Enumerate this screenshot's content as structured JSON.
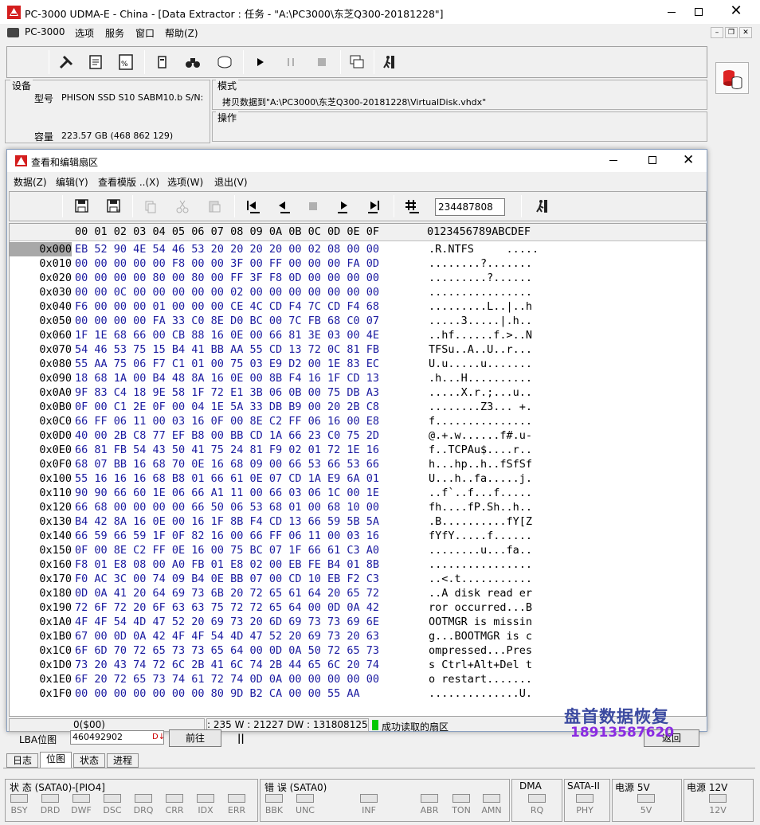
{
  "app": {
    "title": "PC-3000 UDMA-E - China - [Data Extractor : 任务 - \"A:\\PC3000\\东芝Q300-20181228\"]"
  },
  "menubar": [
    "PC-3000",
    "选项",
    "服务",
    "窗口",
    "帮助(Z)"
  ],
  "device": {
    "group": "设备",
    "model_label": "型号",
    "model": "PHISON SSD S10 SABM10.b S/N:",
    "cap_label": "容量",
    "capacity": "223.57 GB (468 862 129)"
  },
  "mode": {
    "label": "模式",
    "text": "拷贝数据到\"A:\\PC3000\\东芝Q300-20181228\\VirtualDisk.vhdx\""
  },
  "operation": {
    "label": "操作"
  },
  "editor": {
    "title": "查看和编辑扇区",
    "menu": [
      "数据(Z)",
      "编辑(Y)",
      "查看模版 ..(X)",
      "选项(W)",
      "退出(V)"
    ],
    "sector_input": "234487808",
    "header_hex": "00 01 02 03 04 05 06 07 08 09 0A 0B 0C 0D 0E 0F",
    "header_ascii": "0123456789ABCDEF",
    "rows": [
      {
        "off": "0x000",
        "hex": "EB 52 90 4E 54 46 53 20 20 20 20 00 02 08 00 00",
        "asc": ".R.NTFS     ....."
      },
      {
        "off": "0x010",
        "hex": "00 00 00 00 00 F8 00 00 3F 00 FF 00 00 00 FA 0D",
        "asc": "........?......."
      },
      {
        "off": "0x020",
        "hex": "00 00 00 00 80 00 80 00 FF 3F F8 0D 00 00 00 00",
        "asc": ".........?......"
      },
      {
        "off": "0x030",
        "hex": "00 00 0C 00 00 00 00 00 02 00 00 00 00 00 00 00",
        "asc": "................"
      },
      {
        "off": "0x040",
        "hex": "F6 00 00 00 01 00 00 00 CE 4C CD F4 7C CD F4 68",
        "asc": ".........L..|..h"
      },
      {
        "off": "0x050",
        "hex": "00 00 00 00 FA 33 C0 8E D0 BC 00 7C FB 68 C0 07",
        "asc": ".....3.....|.h.."
      },
      {
        "off": "0x060",
        "hex": "1F 1E 68 66 00 CB 88 16 0E 00 66 81 3E 03 00 4E",
        "asc": "..hf......f.>..N"
      },
      {
        "off": "0x070",
        "hex": "54 46 53 75 15 B4 41 BB AA 55 CD 13 72 0C 81 FB",
        "asc": "TFSu..A..U..r..."
      },
      {
        "off": "0x080",
        "hex": "55 AA 75 06 F7 C1 01 00 75 03 E9 D2 00 1E 83 EC",
        "asc": "U.u.....u......."
      },
      {
        "off": "0x090",
        "hex": "18 68 1A 00 B4 48 8A 16 0E 00 8B F4 16 1F CD 13",
        "asc": ".h...H.........."
      },
      {
        "off": "0x0A0",
        "hex": "9F 83 C4 18 9E 58 1F 72 E1 3B 06 0B 00 75 DB A3",
        "asc": ".....X.r.;...u.."
      },
      {
        "off": "0x0B0",
        "hex": "0F 00 C1 2E 0F 00 04 1E 5A 33 DB B9 00 20 2B C8",
        "asc": "........Z3... +."
      },
      {
        "off": "0x0C0",
        "hex": "66 FF 06 11 00 03 16 0F 00 8E C2 FF 06 16 00 E8",
        "asc": "f..............."
      },
      {
        "off": "0x0D0",
        "hex": "40 00 2B C8 77 EF B8 00 BB CD 1A 66 23 C0 75 2D",
        "asc": "@.+.w......f#.u-"
      },
      {
        "off": "0x0E0",
        "hex": "66 81 FB 54 43 50 41 75 24 81 F9 02 01 72 1E 16",
        "asc": "f..TCPAu$....r.."
      },
      {
        "off": "0x0F0",
        "hex": "68 07 BB 16 68 70 0E 16 68 09 00 66 53 66 53 66",
        "asc": "h...hp..h..fSfSf"
      },
      {
        "off": "0x100",
        "hex": "55 16 16 16 68 B8 01 66 61 0E 07 CD 1A E9 6A 01",
        "asc": "U...h..fa.....j."
      },
      {
        "off": "0x110",
        "hex": "90 90 66 60 1E 06 66 A1 11 00 66 03 06 1C 00 1E",
        "asc": "..f`..f...f....."
      },
      {
        "off": "0x120",
        "hex": "66 68 00 00 00 00 66 50 06 53 68 01 00 68 10 00",
        "asc": "fh....fP.Sh..h.."
      },
      {
        "off": "0x130",
        "hex": "B4 42 8A 16 0E 00 16 1F 8B F4 CD 13 66 59 5B 5A",
        "asc": ".B..........fY[Z"
      },
      {
        "off": "0x140",
        "hex": "66 59 66 59 1F 0F 82 16 00 66 FF 06 11 00 03 16",
        "asc": "fYfY.....f......"
      },
      {
        "off": "0x150",
        "hex": "0F 00 8E C2 FF 0E 16 00 75 BC 07 1F 66 61 C3 A0",
        "asc": "........u...fa.."
      },
      {
        "off": "0x160",
        "hex": "F8 01 E8 08 00 A0 FB 01 E8 02 00 EB FE B4 01 8B",
        "asc": "................"
      },
      {
        "off": "0x170",
        "hex": "F0 AC 3C 00 74 09 B4 0E BB 07 00 CD 10 EB F2 C3",
        "asc": "..<.t..........."
      },
      {
        "off": "0x180",
        "hex": "0D 0A 41 20 64 69 73 6B 20 72 65 61 64 20 65 72",
        "asc": "..A disk read er"
      },
      {
        "off": "0x190",
        "hex": "72 6F 72 20 6F 63 63 75 72 72 65 64 00 0D 0A 42",
        "asc": "ror occurred...B"
      },
      {
        "off": "0x1A0",
        "hex": "4F 4F 54 4D 47 52 20 69 73 20 6D 69 73 73 69 6E",
        "asc": "OOTMGR is missin"
      },
      {
        "off": "0x1B0",
        "hex": "67 00 0D 0A 42 4F 4F 54 4D 47 52 20 69 73 20 63",
        "asc": "g...BOOTMGR is c"
      },
      {
        "off": "0x1C0",
        "hex": "6F 6D 70 72 65 73 73 65 64 00 0D 0A 50 72 65 73",
        "asc": "ompressed...Pres"
      },
      {
        "off": "0x1D0",
        "hex": "73 20 43 74 72 6C 2B 41 6C 74 2B 44 65 6C 20 74",
        "asc": "s Ctrl+Alt+Del t"
      },
      {
        "off": "0x1E0",
        "hex": "6F 20 72 65 73 74 61 72 74 0D 0A 00 00 00 00 00",
        "asc": "o restart......."
      },
      {
        "off": "0x1F0",
        "hex": "00 00 00 00 00 00 00 80 9D B2 CA 00 00 55 AA",
        "asc": "..............U."
      }
    ],
    "status_pos": "0($00)",
    "status_mid": ": 235 W : 21227 DW : 131808125",
    "status_ok": "成功读取的扇区"
  },
  "lba": {
    "label": "LBA位图",
    "value": "460492902",
    "btn": "前往",
    "btn2": "返回"
  },
  "tabs": [
    "日志",
    "位图",
    "状态",
    "进程"
  ],
  "status": {
    "state_label": "状 态 (SATA0)-[PIO4]",
    "state_leds": [
      "BSY",
      "DRD",
      "DWF",
      "DSC",
      "DRQ",
      "CRR",
      "IDX",
      "ERR"
    ],
    "err_label": "错 误 (SATA0)",
    "err_leds": [
      "BBK",
      "UNC",
      "INF",
      "ABR",
      "TON",
      "AMN"
    ],
    "dma_label": "DMA",
    "dma_led": "RQ",
    "sata_label": "SATA-II",
    "sata_led": "PHY",
    "pw5_label": "电源 5V",
    "pw5_led": "5V",
    "pw12_label": "电源 12V",
    "pw12_led": "12V"
  },
  "watermark": {
    "line1": "盘首数据恢复",
    "line2": "18913587620"
  }
}
